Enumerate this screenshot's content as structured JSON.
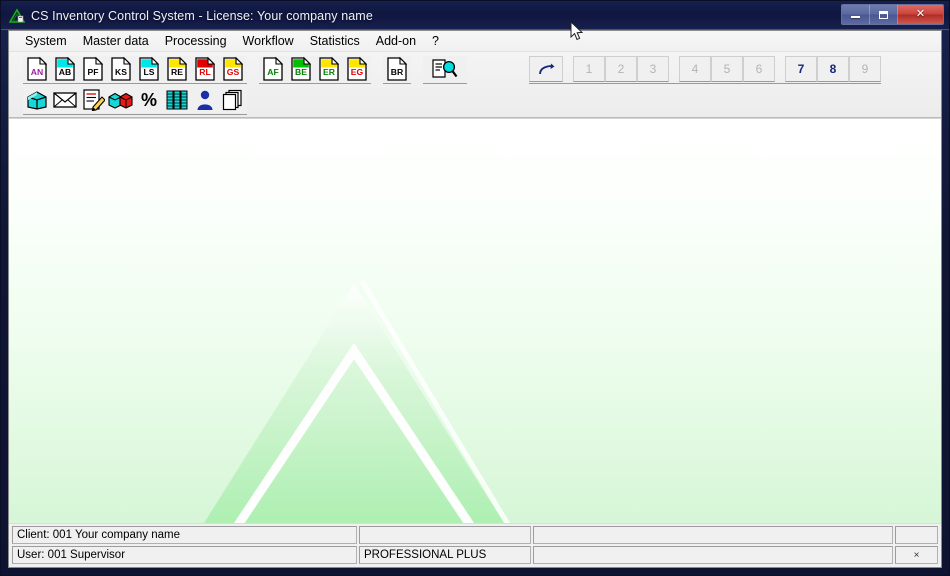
{
  "window": {
    "title": "CS Inventory Control System  -  License: Your company name",
    "app_icon": "green-triangle-icon",
    "controls": {
      "minimize": "minimize-button",
      "maximize": "maximize-button",
      "close": "close-button"
    }
  },
  "menu": {
    "items": [
      {
        "label": "System"
      },
      {
        "label": "Master data"
      },
      {
        "label": "Processing"
      },
      {
        "label": "Workflow"
      },
      {
        "label": "Statistics"
      },
      {
        "label": "Add-on"
      },
      {
        "label": "?"
      }
    ]
  },
  "toolbar": {
    "row1_group1": [
      {
        "code": "AN",
        "icon": "document-an-icon",
        "text_color": "#9b1fa0",
        "corner_color": "#ffffff"
      },
      {
        "code": "AB",
        "icon": "document-ab-icon",
        "text_color": "#000000",
        "corner_color": "#00e5e5"
      },
      {
        "code": "PF",
        "icon": "document-pf-icon",
        "text_color": "#000000",
        "corner_color": "#ffffff"
      },
      {
        "code": "KS",
        "icon": "document-ks-icon",
        "text_color": "#000000",
        "corner_color": "#ffffff"
      },
      {
        "code": "LS",
        "icon": "document-ls-icon",
        "text_color": "#000000",
        "corner_color": "#00e5e5"
      },
      {
        "code": "RE",
        "icon": "document-re-icon",
        "text_color": "#000000",
        "corner_color": "#ffe600"
      },
      {
        "code": "RL",
        "icon": "document-rl-icon",
        "text_color": "#e00000",
        "corner_color": "#e00000"
      },
      {
        "code": "GS",
        "icon": "document-gs-icon",
        "text_color": "#e00000",
        "corner_color": "#ffe600"
      }
    ],
    "row1_group2": [
      {
        "code": "AF",
        "icon": "document-af-icon",
        "text_color": "#008000",
        "corner_color": "#ffffff"
      },
      {
        "code": "BE",
        "icon": "document-be-icon",
        "text_color": "#008000",
        "corner_color": "#00c000"
      },
      {
        "code": "ER",
        "icon": "document-er-icon",
        "text_color": "#008000",
        "corner_color": "#ffe600"
      },
      {
        "code": "EG",
        "icon": "document-eg-icon",
        "text_color": "#e00000",
        "corner_color": "#ffe600"
      }
    ],
    "row1_group3": [
      {
        "code": "BR",
        "icon": "document-br-icon",
        "text_color": "#000000",
        "corner_color": "#ffffff"
      }
    ],
    "row1_group4": [
      {
        "code": "",
        "icon": "document-search-icon",
        "text_color": "#000000",
        "corner_color": "#ffffff"
      }
    ],
    "row2": [
      {
        "icon": "cyan-box-icon",
        "name": "articles-button"
      },
      {
        "icon": "envelope-icon",
        "name": "mail-button"
      },
      {
        "icon": "form-pencil-icon",
        "name": "edit-form-button"
      },
      {
        "icon": "two-cubes-icon",
        "name": "stock-button"
      },
      {
        "icon": "percent-icon",
        "name": "discount-button"
      },
      {
        "icon": "database-stack-icon",
        "name": "database-button"
      },
      {
        "icon": "person-icon",
        "name": "contacts-button"
      },
      {
        "icon": "copy-pages-icon",
        "name": "documents-button"
      }
    ],
    "redo": {
      "icon": "redo-arrow-icon",
      "label": ""
    },
    "numbers": [
      {
        "label": "1",
        "enabled": false
      },
      {
        "label": "2",
        "enabled": false
      },
      {
        "label": "3",
        "enabled": false
      },
      {
        "label": "4",
        "enabled": false
      },
      {
        "label": "5",
        "enabled": false
      },
      {
        "label": "6",
        "enabled": false
      },
      {
        "label": "7",
        "enabled": true
      },
      {
        "label": "8",
        "enabled": true
      },
      {
        "label": "9",
        "enabled": false
      }
    ]
  },
  "workspace": {
    "watermark": "green-triangle-watermark"
  },
  "statusbar": {
    "client_label": "Client: 001  Your company name",
    "client_extra": "",
    "client_right": "",
    "user_label": "User: 001  Supervisor",
    "edition": "PROFESSIONAL PLUS",
    "user_right": "",
    "marker": "×"
  },
  "colors": {
    "title_bar": "#101841",
    "accent_green": "#8ff0a0",
    "chrome": "#f0f0f0",
    "enabled_number": "#17277a",
    "disabled_number": "#b4b4b4"
  }
}
